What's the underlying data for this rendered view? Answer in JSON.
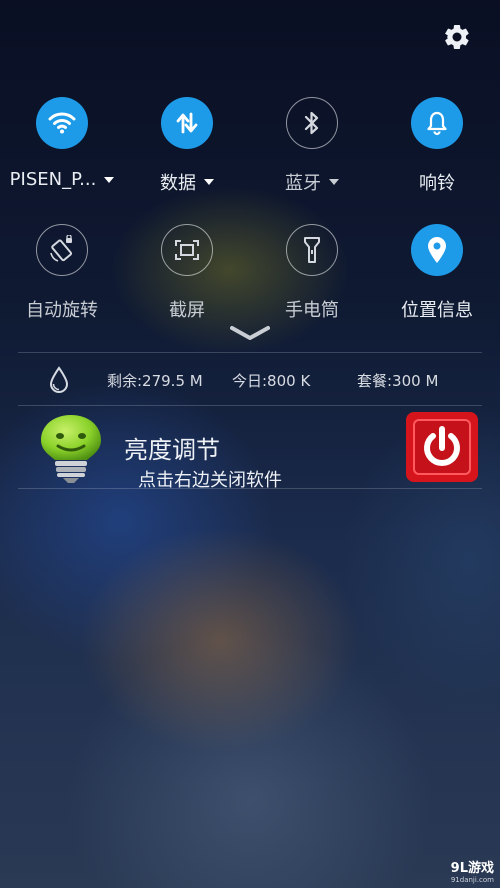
{
  "quick_settings": {
    "row1": [
      {
        "label": "PISEN_P...",
        "icon": "wifi-icon",
        "active": true,
        "dropdown": true
      },
      {
        "label": "数据",
        "icon": "data-arrows-icon",
        "active": true,
        "dropdown": true
      },
      {
        "label": "蓝牙",
        "icon": "bluetooth-icon",
        "active": false,
        "dropdown": true
      },
      {
        "label": "响铃",
        "icon": "bell-icon",
        "active": true,
        "dropdown": false
      }
    ],
    "row2": [
      {
        "label": "自动旋转",
        "icon": "auto-rotate-icon",
        "active": false
      },
      {
        "label": "截屏",
        "icon": "screenshot-icon",
        "active": false
      },
      {
        "label": "手电筒",
        "icon": "flashlight-icon",
        "active": false
      },
      {
        "label": "位置信息",
        "icon": "location-icon",
        "active": true
      }
    ]
  },
  "data_usage": {
    "remaining": "剩余:279.5 M",
    "today": "今日:800 K",
    "plan": "套餐:300 M"
  },
  "notification": {
    "title": "亮度调节",
    "subtitle": "点击右边关闭软件"
  },
  "watermark": {
    "main": "9L游戏",
    "sub": "91danji.com"
  },
  "colors": {
    "accent": "#1e9be8",
    "power_button": "#d6141b",
    "bulb_green": "#8bd22a"
  }
}
